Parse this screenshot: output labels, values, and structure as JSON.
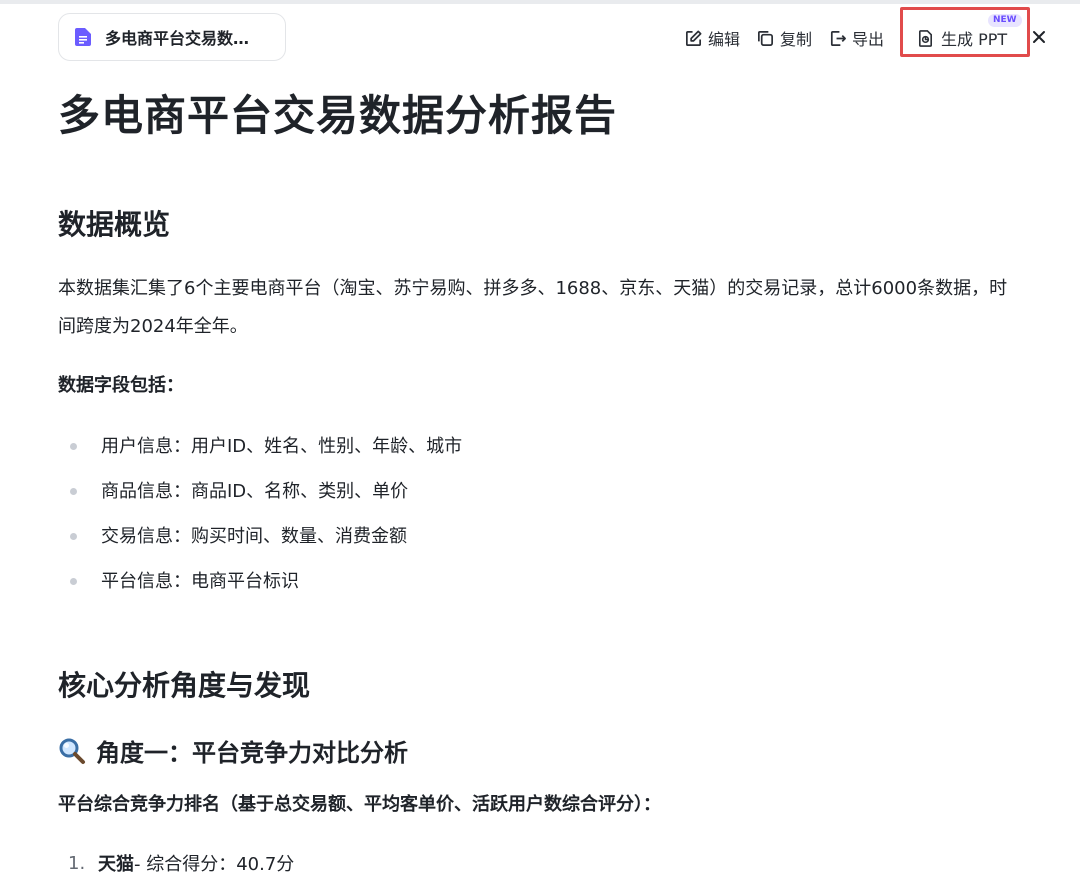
{
  "header": {
    "doc_chip_title": "多电商平台交易数…",
    "toolbar": {
      "edit_label": "编辑",
      "copy_label": "复制",
      "export_label": "导出",
      "ppt_label": "生成 PPT",
      "new_badge": "NEW"
    }
  },
  "document": {
    "title": "多电商平台交易数据分析报告",
    "section1": {
      "heading": "数据概览",
      "paragraph": "本数据集汇集了6个主要电商平台（淘宝、苏宁易购、拼多多、1688、京东、天猫）的交易记录，总计6000条数据，时间跨度为2024年全年。",
      "fields_label": "数据字段包括：",
      "fields": [
        "用户信息：用户ID、姓名、性别、年龄、城市",
        "商品信息：商品ID、名称、类别、单价",
        "交易信息：购买时间、数量、消费金额",
        "平台信息：电商平台标识"
      ]
    },
    "section2": {
      "heading": "核心分析角度与发现",
      "subheading": "角度一：平台竞争力对比分析",
      "subheading_icon": "magnifier-icon",
      "ranking_label": "平台综合竞争力排名（基于总交易额、平均客单价、活跃用户数综合评分）：",
      "ranking": [
        {
          "num": "1.",
          "name": "天猫",
          "detail": " - 综合得分：40.7分"
        }
      ]
    }
  },
  "colors": {
    "accent_red": "#e14b4b",
    "doc_icon": "#6b5cff",
    "badge_text": "#6a4dff"
  }
}
